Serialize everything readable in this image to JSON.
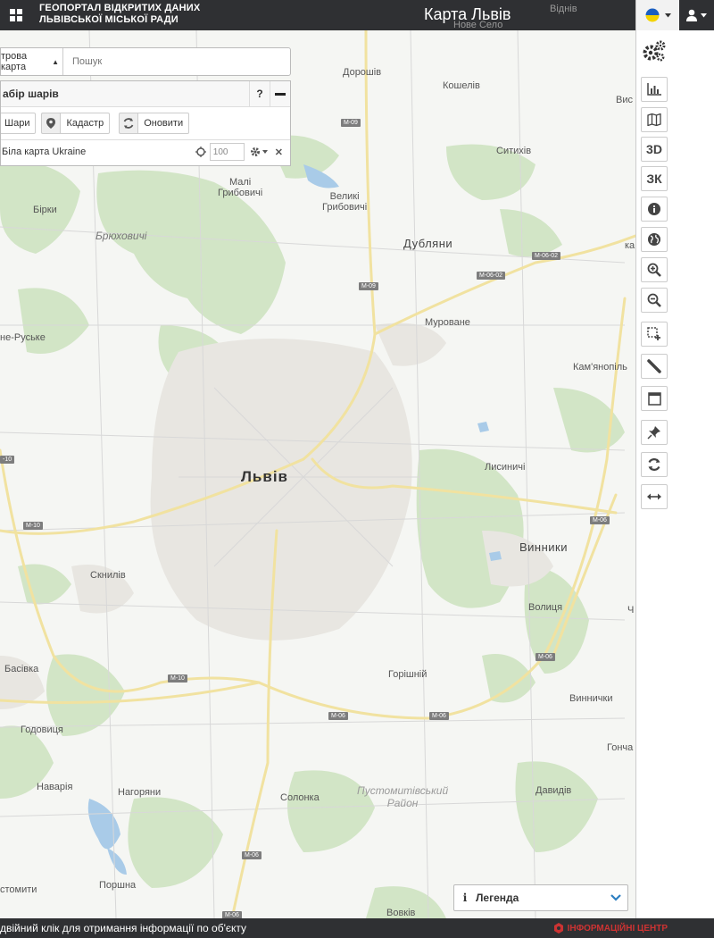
{
  "header": {
    "portal_title_line1": "ГЕОПОРТАЛ ВІДКРИТИХ ДАНИХ",
    "portal_title_line2": "ЛЬВІВСЬКОЇ МІСЬКОЇ РАДИ",
    "map_title": "Карта Львів",
    "behind_labels": [
      "Віднів",
      "Нове Село"
    ],
    "lang_flag_colors": [
      "#1b5fc1",
      "#f4d300"
    ]
  },
  "search": {
    "basemap_select": "трова карта",
    "placeholder": "Пошук"
  },
  "layers_panel": {
    "title": "абір шарів",
    "help_label": "?",
    "buttons": {
      "layers": "Шари",
      "cadastre": "Кадастр",
      "refresh": "Оновити"
    },
    "layer": {
      "name": "Біла карта Ukraine",
      "opacity": "100"
    }
  },
  "toolbar": {
    "tools": [
      {
        "name": "chart-icon",
        "label": ""
      },
      {
        "name": "map-icon",
        "label": ""
      },
      {
        "name": "3d-button",
        "label": "3D"
      },
      {
        "name": "zk-button",
        "label": "ЗК"
      },
      {
        "name": "info-icon",
        "label": ""
      },
      {
        "name": "globe-icon",
        "label": ""
      },
      {
        "name": "zoom-in-icon",
        "label": ""
      },
      {
        "name": "zoom-out-icon",
        "label": ""
      },
      {
        "name": "select-area-icon",
        "label": ""
      },
      {
        "name": "measure-icon",
        "label": ""
      },
      {
        "name": "window-icon",
        "label": ""
      },
      {
        "name": "pin-icon",
        "label": ""
      },
      {
        "name": "refresh-icon",
        "label": ""
      },
      {
        "name": "resize-icon",
        "label": ""
      }
    ]
  },
  "map": {
    "places": {
      "dorosh": "Дорошів",
      "koshelev": "Кошелів",
      "vys": "Вис",
      "sytykhiv": "Ситихів",
      "mali_hrybovychi": "Малі\nГрибовичі",
      "velyki_hrybovychi": "Великі\nГрибовичі",
      "birky": "Бірки",
      "briukhovychi": "Брюховичі",
      "dubliany": "Дубляни",
      "ka": "ка",
      "murovane": "Муроване",
      "ne_ruske": "не-Руське",
      "kamianopil": "Кам'янопіль",
      "lviv": "Львів",
      "lysynychi": "Лисиничі",
      "vynnyky": "Винники",
      "sknyliv": "Скнилів",
      "volytsia": "Волиця",
      "ch": "Ч",
      "basivka": "Басівка",
      "horishnii": "Горішній",
      "vynnychky": "Виннички",
      "hodovytsia": "Годовиця",
      "honcha": "Гонча",
      "navaria": "Наварія",
      "nahoriany": "Нагоряни",
      "solonka": "Солонка",
      "pustomyty_district": "Пустомитівський\nРайон",
      "davydiv": "Давидів",
      "stomyty": "стомити",
      "porshna": "Поршна",
      "vovkiv": "Вовків"
    },
    "roads": {
      "m09a": "M-09",
      "m09b": "M-09",
      "m0602a": "M-06-02",
      "m0602b": "M-06-02",
      "m10a": "-10",
      "m10b": "M-10",
      "m10c": "M-10",
      "m06a": "M-06",
      "m06b": "M-06",
      "m06c": "M-06",
      "m06d": "M-06",
      "m06e": "M-06",
      "m06f": "M-06"
    }
  },
  "legend": {
    "label": "Легенда"
  },
  "status": {
    "text": "двійний клік для отримання інформації по об'єкту",
    "brand": "ІНФОРМАЦІЙНІ ЦЕНТР"
  },
  "colors": {
    "topbar": "#2f3033",
    "forest": "#cfe3c3",
    "water": "#a9cbe8",
    "road": "#f3e5a6",
    "urban": "#e6e3dd",
    "accent": "#2d7fc1"
  }
}
